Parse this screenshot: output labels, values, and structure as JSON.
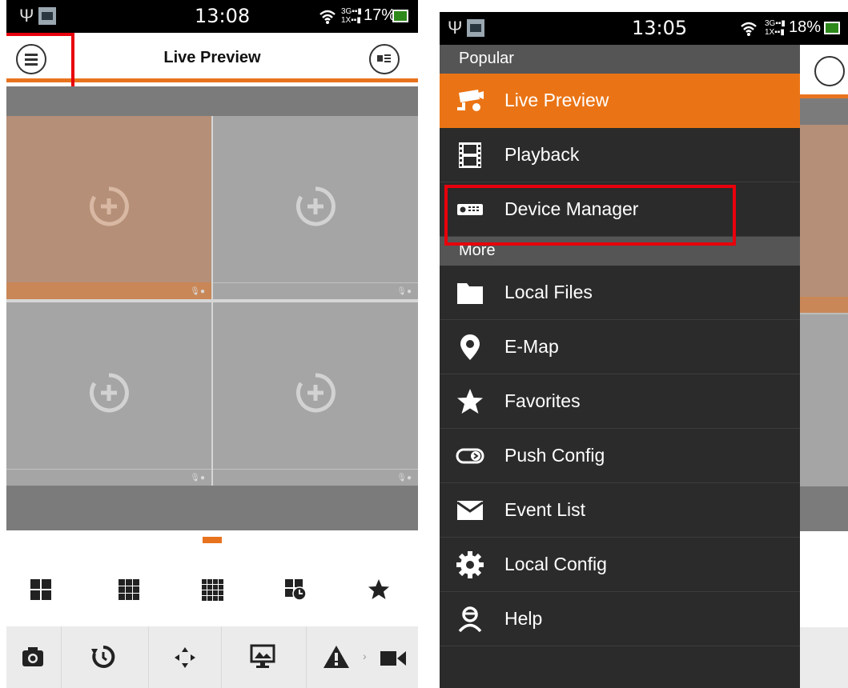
{
  "left": {
    "status": {
      "time": "13:08",
      "battery": "17%",
      "network": "3G-1X"
    },
    "header": {
      "title": "Live Preview"
    },
    "cells": [
      {
        "id": "ch1",
        "selected": true
      },
      {
        "id": "ch2",
        "selected": false
      },
      {
        "id": "ch3",
        "selected": false
      },
      {
        "id": "ch4",
        "selected": false
      }
    ],
    "layout_icons": [
      "layout-4-icon",
      "layout-9-icon",
      "layout-16-icon",
      "schedule-icon",
      "star-icon"
    ],
    "toolbar_icons": [
      "camera-icon",
      "refresh-icon",
      "ptz-move-icon",
      "image-adjust-icon",
      "alarm-icon",
      "video-record-icon"
    ]
  },
  "right": {
    "status": {
      "time": "13:05",
      "battery": "18%",
      "network": "3G-1X"
    },
    "sections": [
      {
        "label": "Popular",
        "items": [
          {
            "label": "Live Preview",
            "icon": "cctv-camera-icon",
            "active": true
          },
          {
            "label": "Playback",
            "icon": "film-strip-icon",
            "active": false
          },
          {
            "label": "Device Manager",
            "icon": "device-manager-icon",
            "active": false
          }
        ]
      },
      {
        "label": "More",
        "items": [
          {
            "label": "Local Files",
            "icon": "folder-icon"
          },
          {
            "label": "E-Map",
            "icon": "map-pin-icon"
          },
          {
            "label": "Favorites",
            "icon": "star-icon"
          },
          {
            "label": "Push Config",
            "icon": "toggle-icon"
          },
          {
            "label": "Event List",
            "icon": "envelope-icon"
          },
          {
            "label": "Local Config",
            "icon": "gear-icon"
          },
          {
            "label": "Help",
            "icon": "person-icon"
          }
        ]
      }
    ]
  },
  "colors": {
    "accent": "#e8731e",
    "highlight": "#e8000b",
    "drawer": "#2b2b2b"
  }
}
